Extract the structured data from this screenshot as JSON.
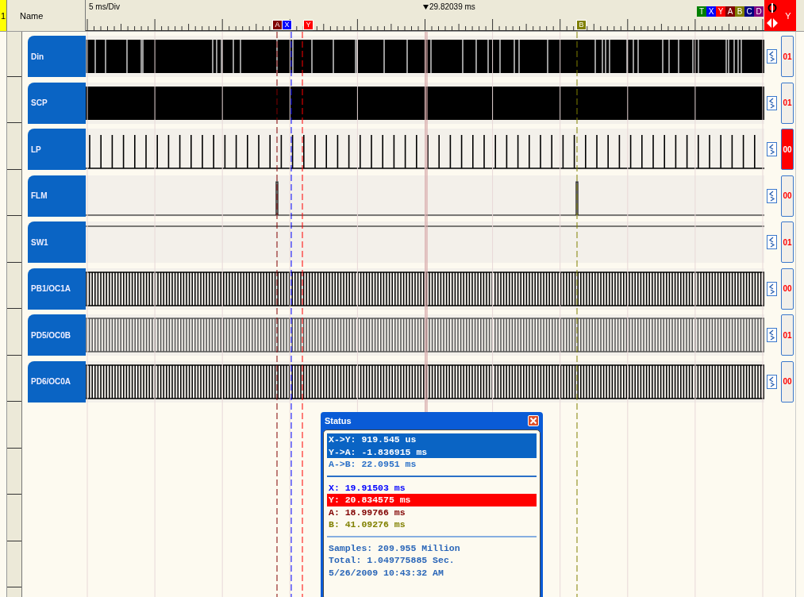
{
  "header": {
    "row_number": "1",
    "name_column": "Name",
    "scale": "5 ms/Div",
    "trigger_time": "29.82039 ms",
    "active_cursor": "Y",
    "cursor_buttons": [
      {
        "label": "T",
        "color": "#008000"
      },
      {
        "label": "X",
        "color": "#0000ff"
      },
      {
        "label": "Y",
        "color": "#ff0000"
      },
      {
        "label": "A",
        "color": "#800000"
      },
      {
        "label": "B",
        "color": "#808000"
      },
      {
        "label": "C",
        "color": "#000080"
      },
      {
        "label": "D",
        "color": "#800080"
      }
    ]
  },
  "cursors": [
    {
      "label": "A",
      "color": "#800000"
    },
    {
      "label": "X",
      "color": "#0000ff"
    },
    {
      "label": "Y",
      "color": "#ff0000"
    },
    {
      "label": "B",
      "color": "#808000"
    }
  ],
  "channels": [
    {
      "name": "Din",
      "kind": "dense",
      "value": "01",
      "selected": false
    },
    {
      "name": "SCP",
      "kind": "solid",
      "value": "01",
      "selected": false
    },
    {
      "name": "LP",
      "kind": "pulses",
      "value": "00",
      "selected": true
    },
    {
      "name": "FLM",
      "kind": "edges",
      "value": "00",
      "selected": false
    },
    {
      "name": "SW1",
      "kind": "high",
      "value": "01",
      "selected": false
    },
    {
      "name": "PB1/OC1A",
      "kind": "clock",
      "value": "00",
      "selected": false
    },
    {
      "name": "PD5/OC0B",
      "kind": "clock_grey",
      "value": "01",
      "selected": false
    },
    {
      "name": "PD6/OC0A",
      "kind": "clock",
      "value": "00",
      "selected": false
    }
  ],
  "status": {
    "title": "Status",
    "deltas": [
      {
        "text": "X->Y: 919.545 us",
        "selected": true
      },
      {
        "text": "Y->A: -1.836915 ms",
        "selected": true
      },
      {
        "text": "A->B: 22.0951 ms",
        "selected": false
      }
    ],
    "positions": [
      {
        "text": "X: 19.91503 ms",
        "color": "#0000ff",
        "selected": false
      },
      {
        "text": "Y: 20.834575 ms",
        "color": "#ff0000",
        "selected": true
      },
      {
        "text": "A: 18.99766 ms",
        "color": "#800000",
        "selected": false
      },
      {
        "text": "B: 41.09276 ms",
        "color": "#808000",
        "selected": false
      }
    ],
    "info": [
      "Samples: 209.955 Million",
      "Total: 1.049775885 Sec.",
      "5/26/2009 10:43:32 AM"
    ]
  }
}
